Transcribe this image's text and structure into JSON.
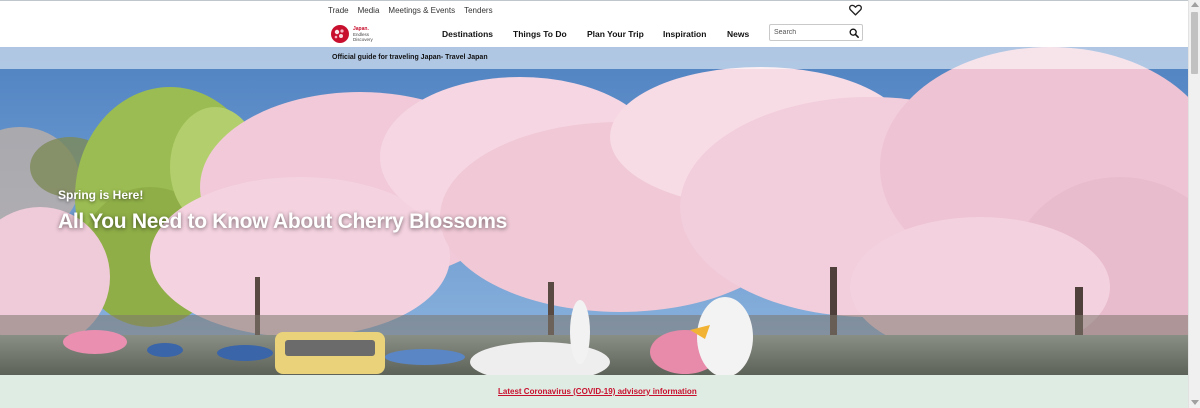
{
  "utility_nav": {
    "items": [
      "Trade",
      "Media",
      "Meetings & Events",
      "Tenders"
    ],
    "favorites_icon": "heart-icon"
  },
  "brand": {
    "logo_line1": "Japan.",
    "logo_line2": "Endless",
    "logo_line3": "Discovery"
  },
  "main_nav": {
    "items": [
      "Destinations",
      "Things To Do",
      "Plan Your Trip",
      "Inspiration",
      "News"
    ]
  },
  "search": {
    "placeholder": "Search",
    "icon": "search-icon"
  },
  "hero": {
    "tagline": "Official guide for traveling Japan- Travel Japan",
    "kicker": "Spring is Here!",
    "headline": "All You Need to Know About Cherry Blossoms"
  },
  "advisory": {
    "link_text": "Latest Coronavirus (COVID-19) advisory information"
  },
  "colors": {
    "accent_red": "#c8102e",
    "advisory_bg": "#dfece3",
    "sky": "#5f8fc8",
    "blossom": "#f3cfdc"
  }
}
